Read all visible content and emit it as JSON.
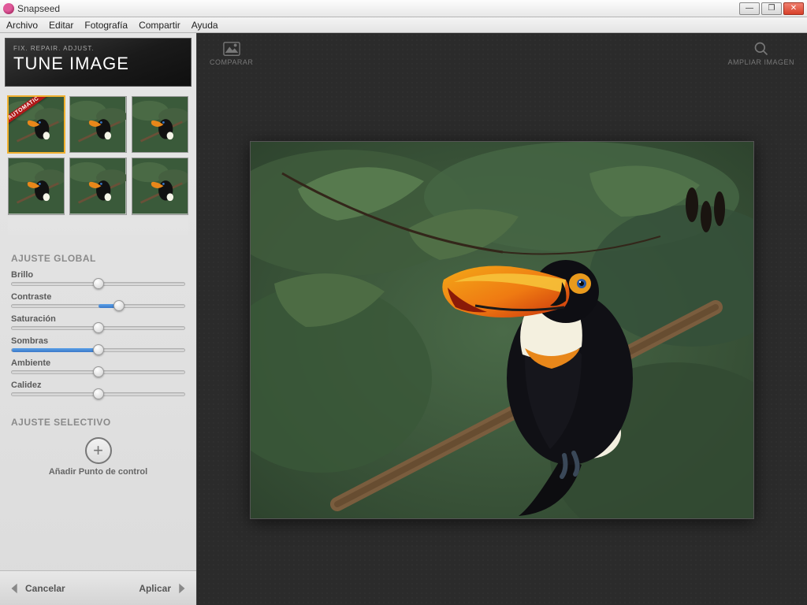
{
  "window": {
    "title": "Snapseed"
  },
  "menu": {
    "items": [
      "Archivo",
      "Editar",
      "Fotografía",
      "Compartir",
      "Ayuda"
    ]
  },
  "header": {
    "subtitle": "FIX. REPAIR. ADJUST.",
    "title": "TUNE IMAGE"
  },
  "toolbar": {
    "compare": "COMPARAR",
    "zoom": "AMPLIAR IMAGEN"
  },
  "presets": {
    "ribbon": "AUTOMATIC"
  },
  "sections": {
    "global": "AJUSTE GLOBAL",
    "selective": "AJUSTE SELECTIVO"
  },
  "sliders": [
    {
      "label": "Brillo",
      "value": 50
    },
    {
      "label": "Contraste",
      "value": 62
    },
    {
      "label": "Saturación",
      "value": 50
    },
    {
      "label": "Sombras",
      "value": 50
    },
    {
      "label": "Ambiente",
      "value": 50
    },
    {
      "label": "Calidez",
      "value": 50
    }
  ],
  "add_control_point": "Añadir Punto de control",
  "footer": {
    "cancel": "Cancelar",
    "apply": "Aplicar"
  }
}
